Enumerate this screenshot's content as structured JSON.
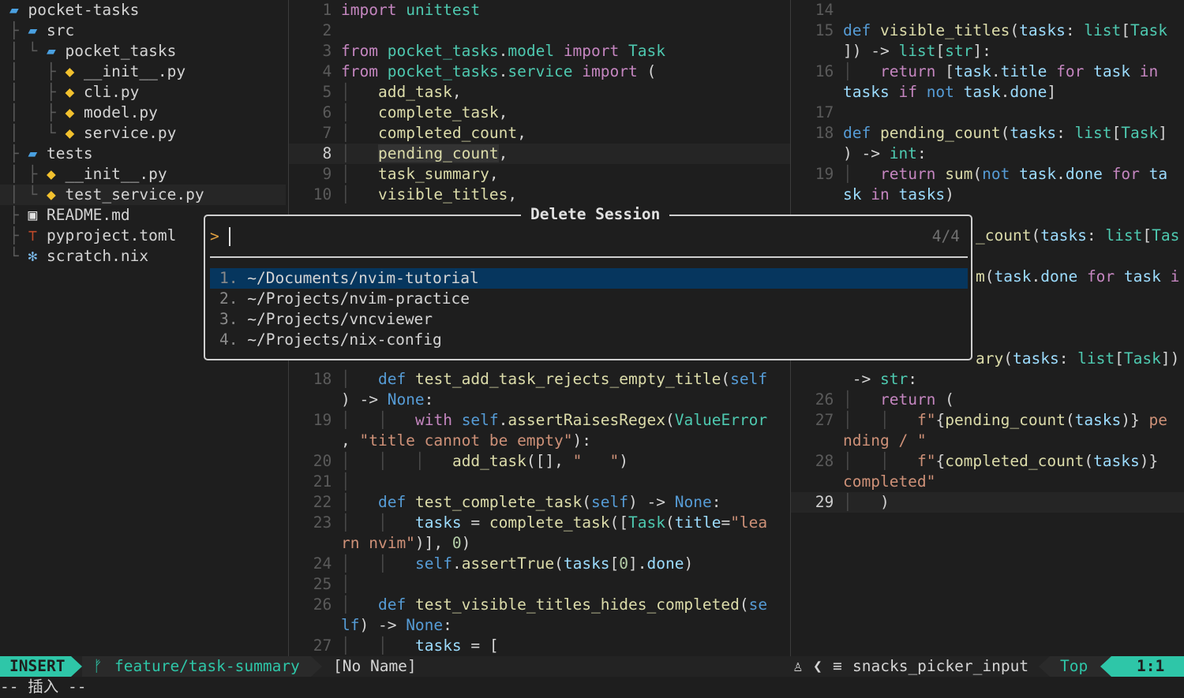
{
  "tree": {
    "items": [
      {
        "prefix": "",
        "icon": "folder-open-icon",
        "name": "pocket-tasks"
      },
      {
        "prefix": "├ ",
        "icon": "folder-open-icon",
        "name": "src"
      },
      {
        "prefix": "│ └ ",
        "icon": "folder-open-icon",
        "name": "pocket_tasks"
      },
      {
        "prefix": "│   ├ ",
        "icon": "python-icon",
        "name": "__init__.py"
      },
      {
        "prefix": "│   ├ ",
        "icon": "python-icon",
        "name": "cli.py"
      },
      {
        "prefix": "│   ├ ",
        "icon": "python-icon",
        "name": "model.py"
      },
      {
        "prefix": "│   └ ",
        "icon": "python-icon",
        "name": "service.py"
      },
      {
        "prefix": "├ ",
        "icon": "folder-open-icon",
        "name": "tests"
      },
      {
        "prefix": "│ ├ ",
        "icon": "python-icon",
        "name": "__init__.py"
      },
      {
        "prefix": "│ └ ",
        "icon": "python-icon",
        "name": "test_service.py"
      },
      {
        "prefix": "├ ",
        "icon": "markdown-icon",
        "name": "README.md"
      },
      {
        "prefix": "├ ",
        "icon": "toml-icon",
        "name": "pyproject.toml"
      },
      {
        "prefix": "└ ",
        "icon": "nix-icon",
        "name": "scratch.nix"
      }
    ]
  },
  "picker": {
    "title": "Delete Session",
    "prompt": ">",
    "count": "4/4",
    "items": [
      {
        "num": "1.",
        "path": "~/Documents/nvim-tutorial"
      },
      {
        "num": "2.",
        "path": "~/Projects/nvim-practice"
      },
      {
        "num": "3.",
        "path": "~/Projects/vncviewer"
      },
      {
        "num": "4.",
        "path": "~/Projects/nix-config"
      }
    ]
  },
  "status": {
    "mode": "INSERT",
    "branch": "feature/task-summary",
    "filename": "[No Name]",
    "filetype": "snacks_picker_input",
    "position": "Top",
    "linecol": "1:1"
  },
  "cmdline": "-- 插入 --",
  "colors": {
    "accent": "#2ec6a8",
    "selection": "#06365e",
    "folder": "#4aa0e0",
    "python": "#f2c12e"
  }
}
